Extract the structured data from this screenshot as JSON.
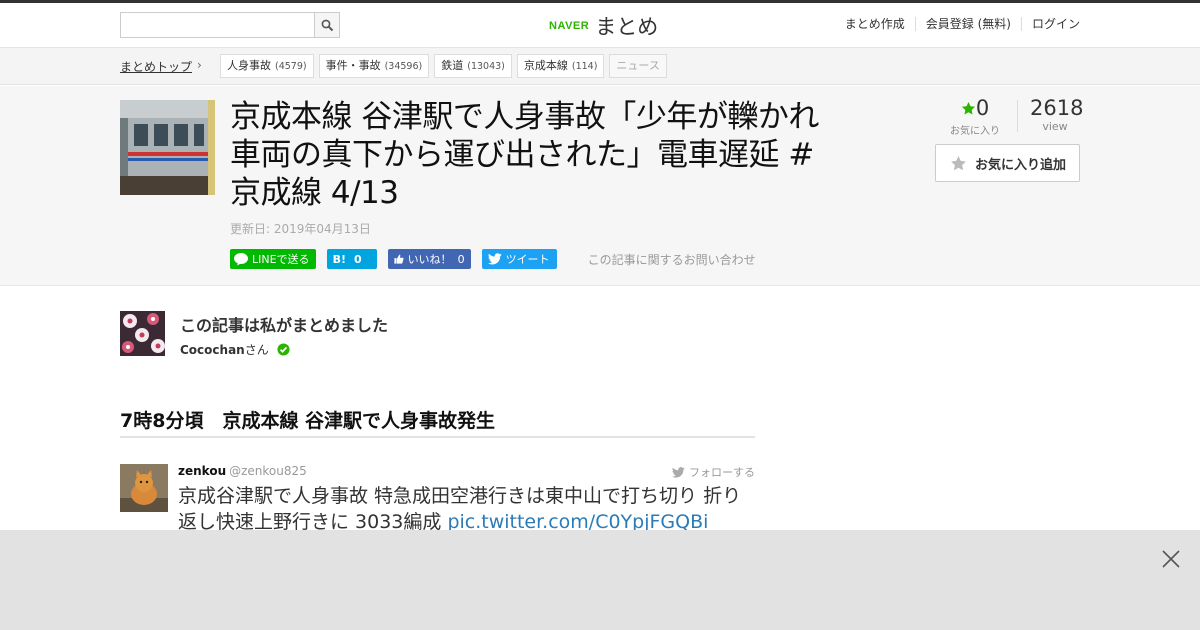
{
  "header": {
    "search_placeholder": "",
    "logo_brand": "NAVER",
    "logo_name": "まとめ",
    "nav": [
      "まとめ作成",
      "会員登録 (無料)",
      "ログイン"
    ]
  },
  "breadcrumb": {
    "top_label": "まとめトップ",
    "tags": [
      {
        "label": "人身事故",
        "count": "(4579)"
      },
      {
        "label": "事件・事故",
        "count": "(34596)"
      },
      {
        "label": "鉄道",
        "count": "(13043)"
      },
      {
        "label": "京成本線",
        "count": "(114)"
      },
      {
        "label": "ニュース",
        "count": ""
      }
    ]
  },
  "article": {
    "title": "京成本線 谷津駅で人身事故「少年が轢かれ車両の真下から運び出された」電車遅延 #京成線 4/13",
    "updated": "更新日: 2019年04月13日",
    "share": {
      "line": "LINEで送る",
      "hatena_count": "0",
      "fb_label": "いいね！",
      "fb_count": "0",
      "tweet": "ツイート"
    },
    "contact": "この記事に関するお問い合わせ",
    "favorites": {
      "count": "0",
      "label": "お気に入り"
    },
    "views": {
      "count": "2618",
      "label": "view"
    },
    "add_favorite": "お気に入り追加"
  },
  "author": {
    "heading": "この記事は私がまとめました",
    "name": "Cocochan",
    "suffix": "さん"
  },
  "section": {
    "heading": "7時8分頃　京成本線 谷津駅で人身事故発生"
  },
  "tweet": {
    "user": "zenkou",
    "handle": "@zenkou825",
    "follow": "フォローする",
    "text": "京成谷津駅で人身事故 特急成田空港行きは東中山で打ち切り 折り返し快速上野行きに 3033編成 ",
    "link": "pic.twitter.com/C0YpjFGQBi"
  },
  "colors": {
    "accent_green": "#2db400",
    "line_green": "#00b900",
    "hatena_blue": "#00a4de",
    "facebook_blue": "#4267b2",
    "twitter_blue": "#1da1f2",
    "link_blue": "#2b7bb9"
  }
}
